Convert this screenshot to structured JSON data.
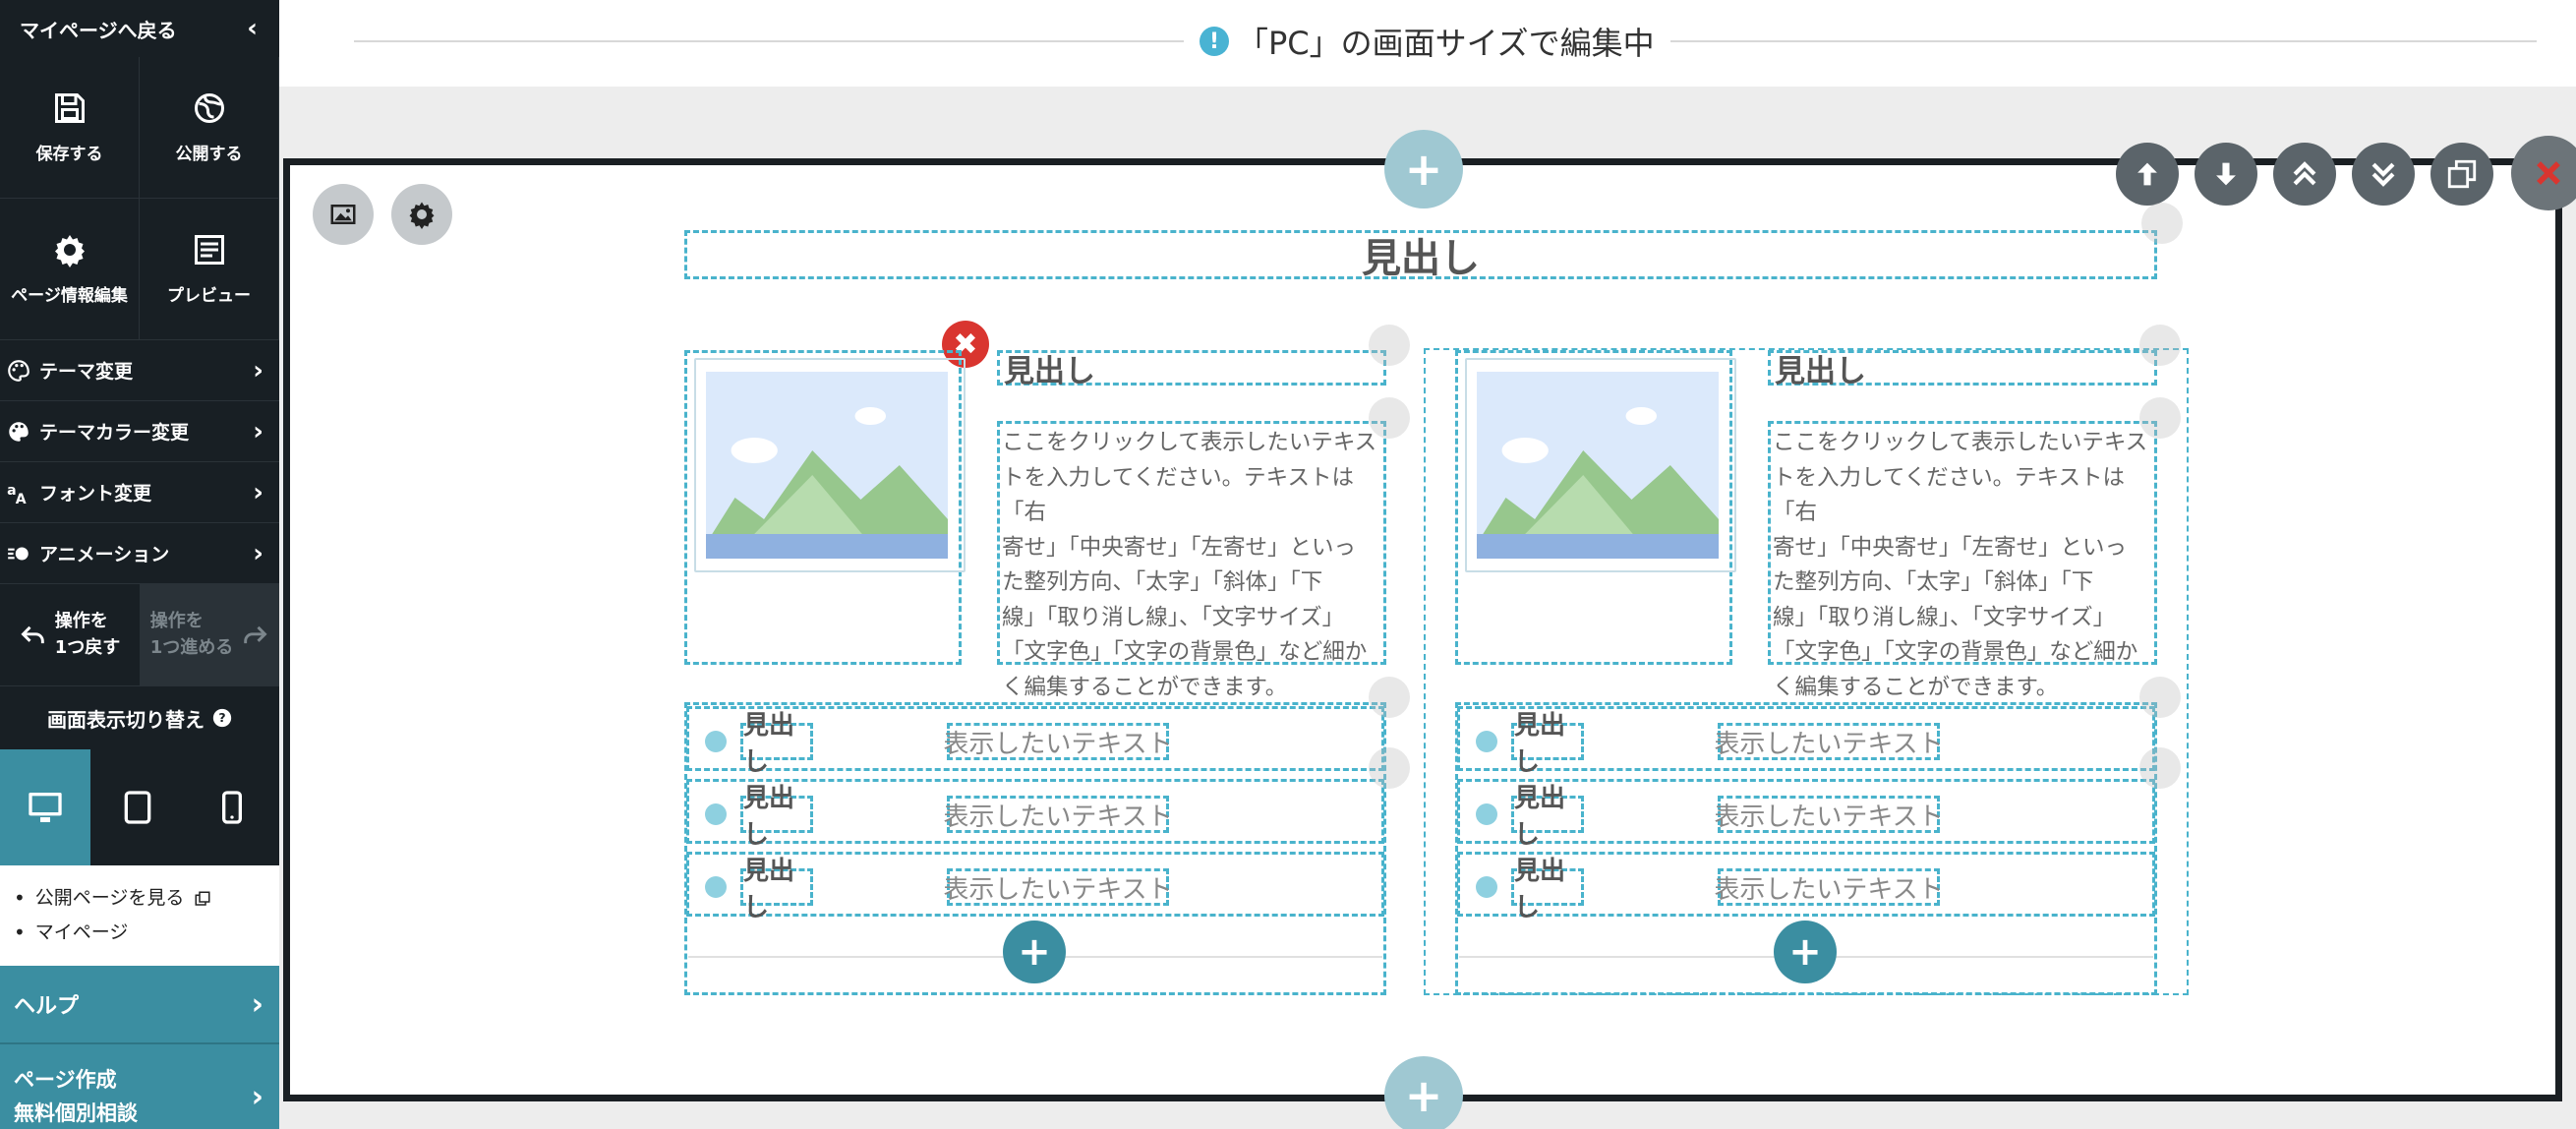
{
  "sidebar": {
    "back_label": "マイページへ戻る",
    "grid": [
      {
        "label": "保存する",
        "icon": "save-icon"
      },
      {
        "label": "公開する",
        "icon": "publish-icon"
      },
      {
        "label": "ページ情報編集",
        "icon": "gear-icon"
      },
      {
        "label": "プレビュー",
        "icon": "preview-icon"
      }
    ],
    "menu": [
      {
        "label": "テーマ変更",
        "icon": "palette-icon"
      },
      {
        "label": "テーマカラー変更",
        "icon": "palette-icon"
      },
      {
        "label": "フォント変更",
        "icon": "font-icon"
      },
      {
        "label": "アニメーション",
        "icon": "animation-icon"
      }
    ],
    "undo": {
      "line1": "操作を",
      "line2": "1つ戻す"
    },
    "redo": {
      "line1": "操作を",
      "line2": "1つ進める"
    },
    "switch_label": "画面表示切り替え",
    "links": [
      "公開ページを見る",
      "マイページ"
    ],
    "help_label": "ヘルプ",
    "consult": {
      "line1": "ページ作成",
      "line2": "無料個別相談"
    }
  },
  "banner": {
    "message": "「PC」の画面サイズで編集中"
  },
  "content": {
    "main_heading": "見出し",
    "columns": [
      {
        "heading": "見出し",
        "text_lines": [
          "ここをクリックして表示したいテキス",
          "トを入力してください。テキストは「右",
          "寄せ」「中央寄せ」「左寄せ」といっ",
          "た整列方向、「太字」「斜体」「下",
          "線」「取り消し線」、「文字サイズ」",
          "「文字色」「文字の背景色」など細か",
          "く編集することができます。"
        ],
        "list": [
          {
            "heading": "見出し",
            "text": "表示したいテキスト"
          },
          {
            "heading": "見出し",
            "text": "表示したいテキスト"
          },
          {
            "heading": "見出し",
            "text": "表示したいテキスト"
          }
        ]
      },
      {
        "heading": "見出し",
        "text_lines": [
          "ここをクリックして表示したいテキス",
          "トを入力してください。テキストは「右",
          "寄せ」「中央寄せ」「左寄せ」といっ",
          "た整列方向、「太字」「斜体」「下",
          "線」「取り消し線」、「文字サイズ」",
          "「文字色」「文字の背景色」など細か",
          "く編集することができます。"
        ],
        "list": [
          {
            "heading": "見出し",
            "text": "表示したいテキスト"
          },
          {
            "heading": "見出し",
            "text": "表示したいテキスト"
          },
          {
            "heading": "見出し",
            "text": "表示したいテキスト"
          }
        ]
      }
    ]
  },
  "colors": {
    "sidebar_bg": "#181f24",
    "accent": "#3b8ea1",
    "dashed": "#49b3cc",
    "delete": "#d9352f"
  }
}
